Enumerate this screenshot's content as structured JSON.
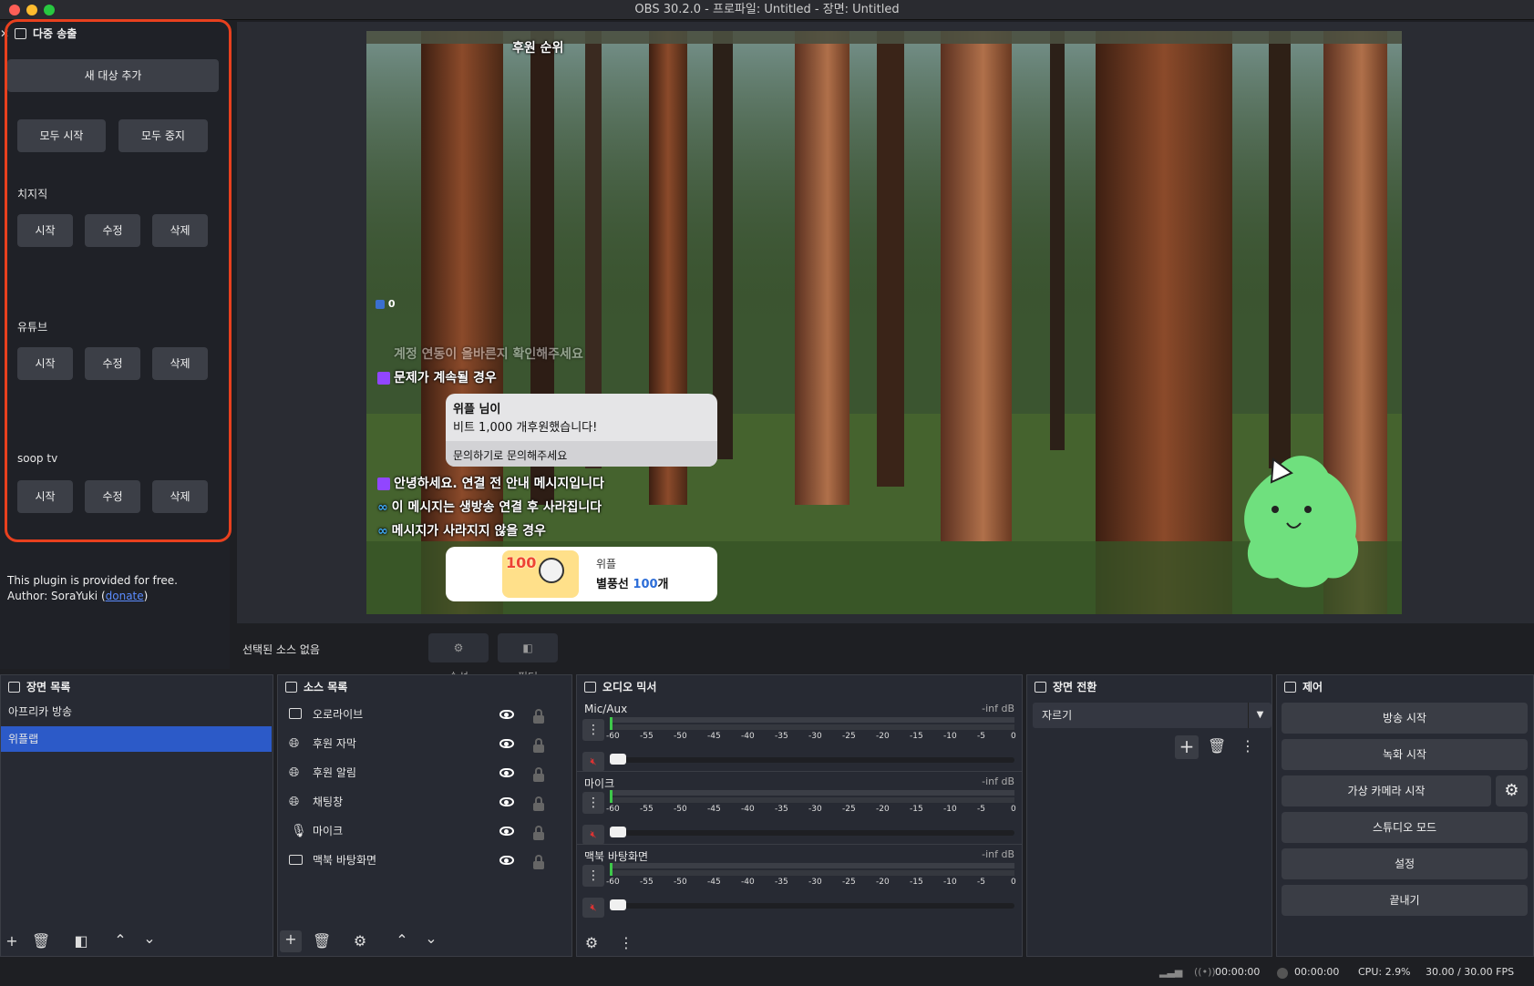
{
  "window": {
    "title": "OBS 30.2.0 - 프로파일: Untitled - 장면: Untitled"
  },
  "multistream": {
    "title": "다중 송출",
    "add_target": "새 대상 추가",
    "start_all": "모두 시작",
    "stop_all": "모두 중지",
    "targets": [
      {
        "name": "치지직",
        "start": "시작",
        "edit": "수정",
        "delete": "삭제"
      },
      {
        "name": "유튜브",
        "start": "시작",
        "edit": "수정",
        "delete": "삭제"
      },
      {
        "name": "soop tv",
        "start": "시작",
        "edit": "수정",
        "delete": "삭제"
      }
    ],
    "footer_line1": "This plugin is provided for free.",
    "footer_author_prefix": "Author: SoraYuki (",
    "footer_donate": "donate",
    "footer_suffix": ")"
  },
  "preview": {
    "overlay_title": "후원 순위",
    "counter": "0",
    "chat_lines": [
      "계정 연동이 올바른지 확인해주세요",
      "문제가 계속될 경우"
    ],
    "alert_name": "위플 님이",
    "alert_message": "비트 1,000 개후원했습니다!",
    "alert_footer": "문의하기로 문의해주세요",
    "chat_lines2": [
      "안녕하세요. 연결 전 안내 메시지입니다",
      "이 메시지는 생방송 연결 후 사라집니다",
      "메시지가 사라지지 않을 경우"
    ],
    "balloon_user": "위플",
    "balloon_prefix": "별풍선 ",
    "balloon_count": "100",
    "balloon_suffix": "개",
    "balloon_badge": "100"
  },
  "source_toolbar": {
    "no_source": "선택된 소스 없음",
    "properties": "속성",
    "filters": "필터"
  },
  "scenes": {
    "title": "장면 목록",
    "items": [
      "아프리카 방송",
      "위플랩"
    ],
    "selected": 1
  },
  "sources": {
    "title": "소스 목록",
    "items": [
      {
        "name": "오로라이브",
        "icon": "image-icon"
      },
      {
        "name": "후원 자막",
        "icon": "globe-icon"
      },
      {
        "name": "후원 알림",
        "icon": "globe-icon"
      },
      {
        "name": "채팅창",
        "icon": "globe-icon"
      },
      {
        "name": "마이크",
        "icon": "mic-icon"
      },
      {
        "name": "맥북 바탕화면",
        "icon": "monitor-icon"
      }
    ]
  },
  "mixer": {
    "title": "오디오 믹서",
    "channels": [
      {
        "name": "Mic/Aux",
        "level": "-inf dB"
      },
      {
        "name": "마이크",
        "level": "-inf dB"
      },
      {
        "name": "맥북 바탕화면",
        "level": "-inf dB"
      }
    ],
    "ticks": [
      "-60",
      "-55",
      "-50",
      "-45",
      "-40",
      "-35",
      "-30",
      "-25",
      "-20",
      "-15",
      "-10",
      "-5",
      "0"
    ]
  },
  "transitions": {
    "title": "장면 전환",
    "selected": "자르기"
  },
  "controls": {
    "title": "제어",
    "start_stream": "방송 시작",
    "start_record": "녹화 시작",
    "start_vcam": "가상 카메라 시작",
    "studio_mode": "스튜디오 모드",
    "settings": "설정",
    "exit": "끝내기"
  },
  "status": {
    "stream_time": "00:00:00",
    "rec_time": "00:00:00",
    "cpu": "CPU: 2.9%",
    "fps": "30.00 / 30.00 FPS"
  },
  "colors": {
    "accent": "#2c5ac8",
    "highlight_border": "#e8401e",
    "panel": "#272a33"
  }
}
